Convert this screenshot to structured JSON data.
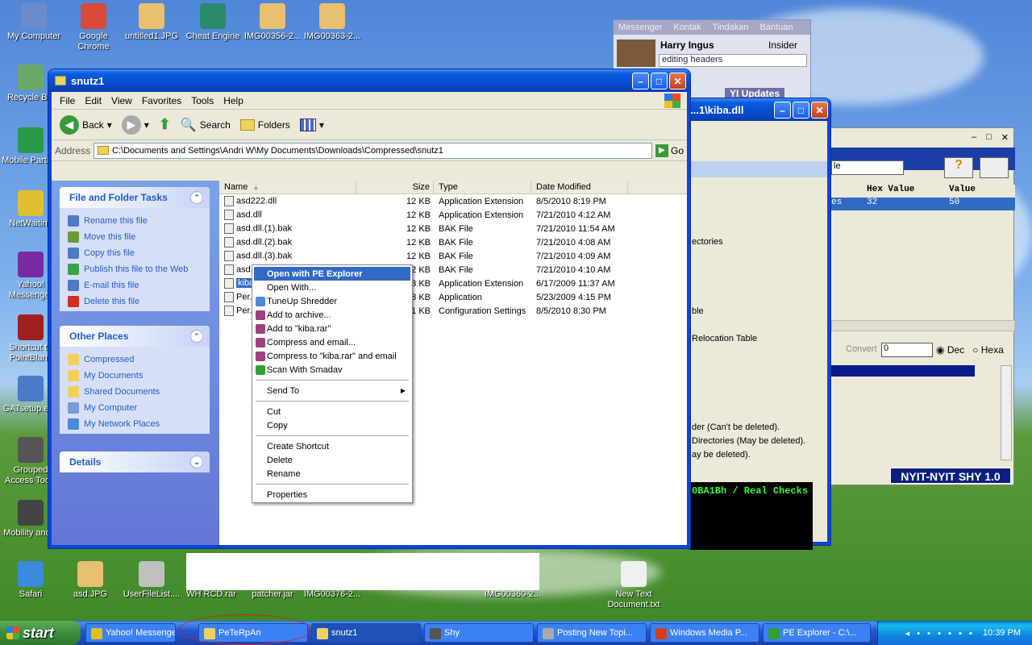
{
  "desktop_icons": [
    {
      "label": "My Computer",
      "icon": "computer-icon",
      "color": "#6a8ccc"
    },
    {
      "label": "Google Chrome",
      "icon": "chrome-icon",
      "color": "#d94a3a"
    },
    {
      "label": "untitled1.JPG",
      "icon": "image-icon",
      "color": "#e8c070"
    },
    {
      "label": "Cheat Engine",
      "icon": "cheat-engine-icon",
      "color": "#2a8a6a"
    },
    {
      "label": "IMG00356-2...",
      "icon": "image-icon",
      "color": "#e8c070"
    },
    {
      "label": "IMG00363-2...",
      "icon": "image-icon",
      "color": "#e8c070"
    },
    {
      "label": "Recycle Bin",
      "icon": "recycle-bin-icon",
      "color": "#6aa86a"
    },
    {
      "label": "Mobile Partner",
      "icon": "mobile-partner-icon",
      "color": "#2a9a4a"
    },
    {
      "label": "NetWaiting",
      "icon": "netwaiting-icon",
      "color": "#e0c030"
    },
    {
      "label": "Yahoo! Messenger",
      "icon": "yahoo-icon",
      "color": "#7a2aa0"
    },
    {
      "label": "Shortcut to PointBlank",
      "icon": "pointblank-icon",
      "color": "#a02020"
    },
    {
      "label": "GATsetup.exe",
      "icon": "setup-icon",
      "color": "#4a7ac8"
    },
    {
      "label": "Grouped Access Tools",
      "icon": "tools-icon",
      "color": "#555555"
    },
    {
      "label": "Mobility and...",
      "icon": "mobility-icon",
      "color": "#444444"
    },
    {
      "label": "Safari",
      "icon": "safari-icon",
      "color": "#3a8ae0"
    },
    {
      "label": "asd.JPG",
      "icon": "image-icon",
      "color": "#e8c070"
    },
    {
      "label": "UserFileList....",
      "icon": "file-icon",
      "color": "#c0c0c0"
    },
    {
      "label": "WH RCD.rar",
      "icon": "rar-icon",
      "color": "#a04080"
    },
    {
      "label": "patcher.jar",
      "icon": "jar-icon",
      "color": "#c08040"
    },
    {
      "label": "IMG00376-2...",
      "icon": "image-icon",
      "color": "#e8c070"
    },
    {
      "label": "IMG00360-2...",
      "icon": "image-icon",
      "color": "#e8c070"
    },
    {
      "label": "New Text Document.txt",
      "icon": "text-file-icon",
      "color": "#f0f0f0"
    }
  ],
  "explorer": {
    "title": "snutz1",
    "menu": [
      "File",
      "Edit",
      "View",
      "Favorites",
      "Tools",
      "Help"
    ],
    "toolbar": {
      "back": "Back",
      "search": "Search",
      "folders": "Folders"
    },
    "address_label": "Address",
    "address_value": "C:\\Documents and Settings\\Andri W\\My Documents\\Downloads\\Compressed\\snutz1",
    "go_label": "Go",
    "tasks_title": "File and Folder Tasks",
    "tasks": [
      "Rename this file",
      "Move this file",
      "Copy this file",
      "Publish this file to the Web",
      "E-mail this file",
      "Delete this file"
    ],
    "places_title": "Other Places",
    "places": [
      "Compressed",
      "My Documents",
      "Shared Documents",
      "My Computer",
      "My Network Places"
    ],
    "details_title": "Details",
    "columns": [
      "Name",
      "Size",
      "Type",
      "Date Modified"
    ],
    "files": [
      {
        "name": "asd222.dll",
        "size": "12 KB",
        "type": "Application Extension",
        "date": "8/5/2010 8:19 PM"
      },
      {
        "name": "asd.dll",
        "size": "12 KB",
        "type": "Application Extension",
        "date": "7/21/2010 4:12 AM"
      },
      {
        "name": "asd.dll.(1).bak",
        "size": "12 KB",
        "type": "BAK File",
        "date": "7/21/2010 11:54 AM"
      },
      {
        "name": "asd.dll.(2).bak",
        "size": "12 KB",
        "type": "BAK File",
        "date": "7/21/2010 4:08 AM"
      },
      {
        "name": "asd.dll.(3).bak",
        "size": "12 KB",
        "type": "BAK File",
        "date": "7/21/2010 4:09 AM"
      },
      {
        "name": "asd.dll.(4).bak",
        "size": "12 KB",
        "type": "BAK File",
        "date": "7/21/2010 4:10 AM"
      },
      {
        "name": "kiba.dll",
        "size": "13 KB",
        "type": "Application Extension",
        "date": "6/17/2009 11:37 AM"
      },
      {
        "name": "Per...",
        "size": "263 KB",
        "type": "Application",
        "date": "5/23/2009 4:15 PM"
      },
      {
        "name": "Per...",
        "size": "1 KB",
        "type": "Configuration Settings",
        "date": "8/5/2010 8:30 PM"
      }
    ]
  },
  "context_menu": {
    "group1": [
      "Open with PE Explorer",
      "Open With...",
      "TuneUp Shredder",
      "Add to archive...",
      "Add to \"kiba.rar\"",
      "Compress and email...",
      "Compress to \"kiba.rar\" and email",
      "Scan With Smadav"
    ],
    "send_to": "Send To",
    "group3": [
      "Cut",
      "Copy"
    ],
    "group4": [
      "Create Shortcut",
      "Delete",
      "Rename"
    ],
    "properties": "Properties"
  },
  "messenger": {
    "menu": [
      "Messenger",
      "Kontak",
      "Tindakan",
      "Bantuan"
    ],
    "name": "Harry Ingus",
    "status_label": "Insider",
    "status_text": "editing headers",
    "updates": "YI Updates"
  },
  "pe_window": {
    "title": "...1\\kiba.dll",
    "items": [
      "ectories",
      "ble",
      "Relocation Table",
      "der (Can't be deleted).",
      "Directories (May be deleted).",
      "ay be deleted)."
    ],
    "console": "0BA1Bh / Real Checks"
  },
  "hex_window": {
    "col1": "es",
    "hex_header": "Hex Value",
    "val_header": "Value",
    "hex_value": "32",
    "value": "50",
    "combo": "le",
    "convert": "Convert",
    "convert_value": "0",
    "dec": "Dec",
    "hexa": "Hexa",
    "banner": "NYIT-NYIT SHY 1.0"
  },
  "taskbar": {
    "start": "start",
    "items": [
      "Yahoo! Messenger",
      "PeTeRpAn",
      "snutz1",
      "Shy",
      "Posting New Topi...",
      "Windows Media P...",
      "PE Explorer - C:\\..."
    ],
    "clock": "10:39 PM"
  }
}
